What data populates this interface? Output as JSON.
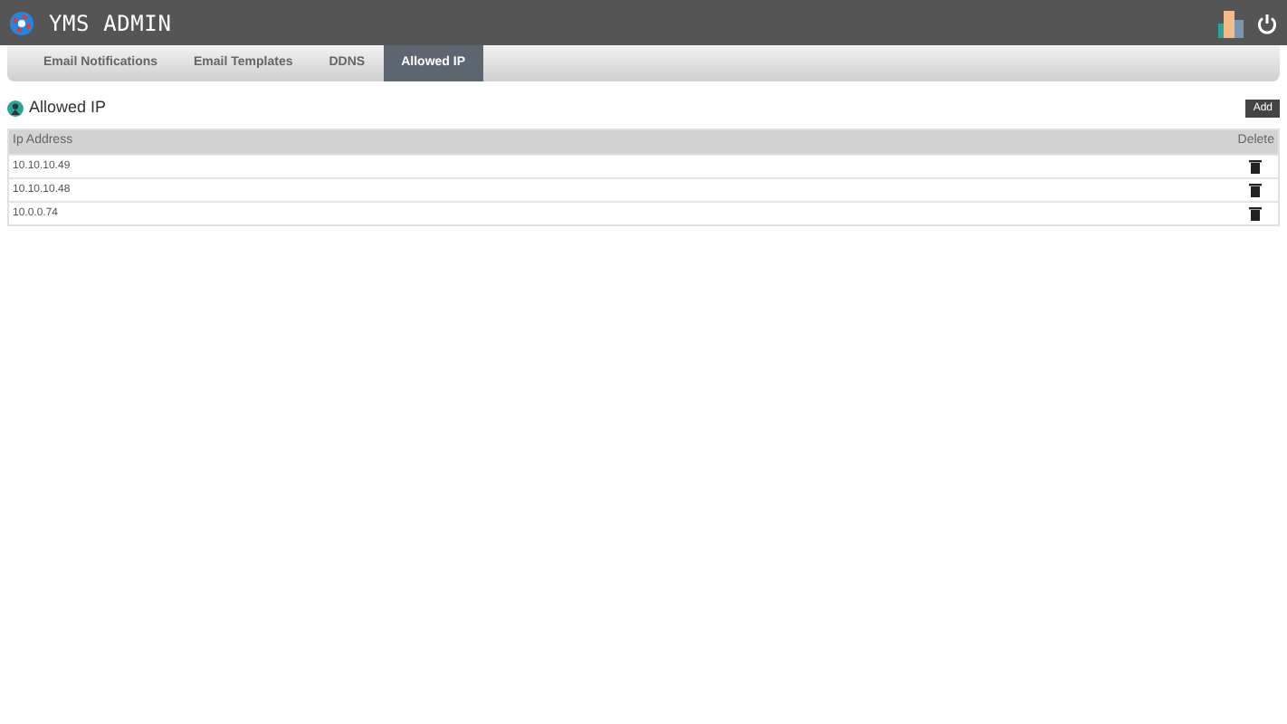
{
  "header": {
    "title": "YMS ADMIN"
  },
  "tabs": [
    {
      "label": "Email Notifications",
      "selected": false
    },
    {
      "label": "Email Templates",
      "selected": false
    },
    {
      "label": "DDNS",
      "selected": false
    },
    {
      "label": "Allowed IP",
      "selected": true
    }
  ],
  "section": {
    "title": "Allowed IP",
    "add_button": "Add"
  },
  "table": {
    "columns": [
      "Ip Address",
      "Delete"
    ],
    "rows": [
      {
        "ip": "10.10.10.49"
      },
      {
        "ip": "10.10.10.48"
      },
      {
        "ip": "10.0.0.74"
      }
    ]
  }
}
